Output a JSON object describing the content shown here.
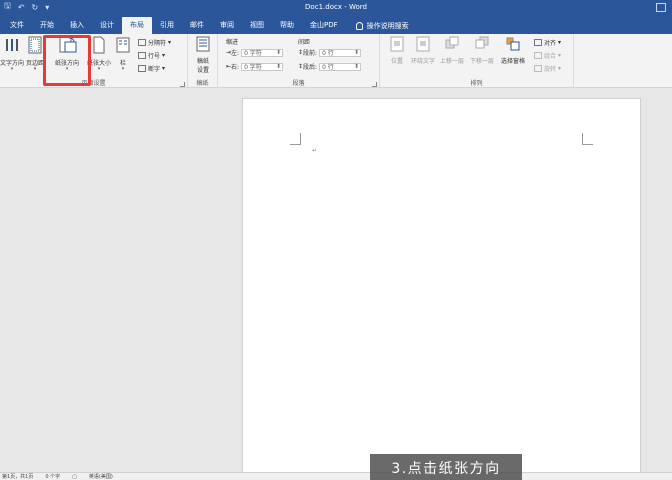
{
  "window": {
    "title": "Doc1.docx - Word"
  },
  "quick_access": {
    "save": "🖫",
    "undo": "↶",
    "redo": "↻",
    "more": "▾"
  },
  "tabs": [
    {
      "label": "文件"
    },
    {
      "label": "开始"
    },
    {
      "label": "插入"
    },
    {
      "label": "设计"
    },
    {
      "label": "布局",
      "active": true
    },
    {
      "label": "引用"
    },
    {
      "label": "邮件"
    },
    {
      "label": "审阅"
    },
    {
      "label": "视图"
    },
    {
      "label": "帮助"
    },
    {
      "label": "金山PDF"
    }
  ],
  "tell_me": "操作说明搜索",
  "ribbon": {
    "page_setup": {
      "group_label": "页面设置",
      "text_direction": "文字方向",
      "margins": "页边距",
      "orientation": "纸张方向",
      "size": "纸张大小",
      "columns": "栏",
      "breaks": "分隔符",
      "line_numbers": "行号",
      "hyphenation": "断字"
    },
    "manuscript": {
      "group_label": "稿纸",
      "settings_line1": "稿纸",
      "settings_line2": "设置"
    },
    "paragraph": {
      "group_label": "段落",
      "indent_header": "缩进",
      "spacing_header": "间距",
      "left_label": "左:",
      "left_value": "0 字符",
      "right_label": "右:",
      "right_value": "0 字符",
      "before_label": "段前:",
      "before_value": "0 行",
      "after_label": "段后:",
      "after_value": "0 行"
    },
    "arrange": {
      "group_label": "排列",
      "position": "位置",
      "wrap_text": "环绕文字",
      "bring_forward": "上移一层",
      "send_backward": "下移一层",
      "selection_pane": "选择窗格",
      "align": "对齐",
      "group": "组合",
      "rotate": "旋转"
    }
  },
  "statusbar": {
    "page": "第1页，共1页",
    "words": "0 个字",
    "language": "英语(美国)"
  },
  "subtitle": "3.点击纸张方向"
}
